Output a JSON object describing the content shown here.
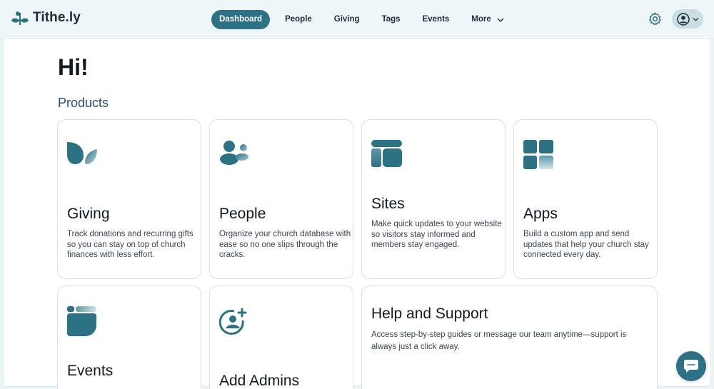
{
  "brand": {
    "name": "Tithe.ly",
    "accent": "#2d7184"
  },
  "nav": {
    "items": [
      {
        "label": "Dashboard",
        "active": true
      },
      {
        "label": "People",
        "active": false
      },
      {
        "label": "Giving",
        "active": false
      },
      {
        "label": "Tags",
        "active": false
      },
      {
        "label": "Events",
        "active": false
      }
    ],
    "more_label": "More",
    "settings_icon": "gear-icon",
    "user_icon": "user-avatar-icon"
  },
  "main": {
    "greeting": "Hi!",
    "section_title": "Products",
    "cards": [
      {
        "icon": "giving-leaf-icon",
        "title": "Giving",
        "desc": "Track donations and recurring gifts so you can stay on top of church finances with less effort."
      },
      {
        "icon": "people-icon",
        "title": "People",
        "desc": "Organize your church database with ease so no one slips through the cracks."
      },
      {
        "icon": "sites-icon",
        "title": "Sites",
        "desc": "Make quick updates to your website so visitors stay informed and members stay engaged."
      },
      {
        "icon": "apps-grid-icon",
        "title": "Apps",
        "desc": "Build a custom app and send updates that help your church stay connected every day."
      },
      {
        "icon": "events-icon",
        "title": "Events",
        "desc": ""
      },
      {
        "icon": "add-admin-icon",
        "title": "Add Admins",
        "desc": ""
      },
      {
        "icon": "",
        "title": "Help and Support",
        "desc": "Access step-by-step guides or message our team anytime—support is always just a click away."
      }
    ]
  },
  "chat": {
    "icon": "chat-bubble-icon"
  }
}
